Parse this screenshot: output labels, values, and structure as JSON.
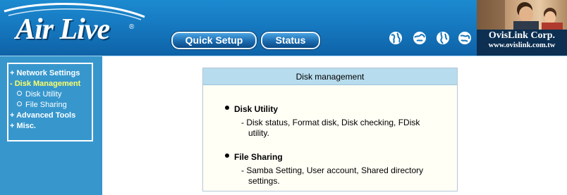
{
  "header": {
    "logo_text": "Air Live",
    "logo_mark": "®",
    "nav": [
      {
        "label": "Quick Setup"
      },
      {
        "label": "Status"
      }
    ],
    "icons": [
      "globe-icon",
      "globe-icon",
      "globe-icon",
      "globe-icon"
    ],
    "brand": {
      "name": "OvisLink Corp.",
      "url": "www.ovislink.com.tw"
    }
  },
  "sidebar": {
    "items": [
      {
        "label": "+ Network Settings",
        "active": false
      },
      {
        "label": "- Disk Management",
        "active": true
      },
      {
        "label": "Disk Utility",
        "sub": true
      },
      {
        "label": "File Sharing",
        "sub": true
      },
      {
        "label": "+ Advanced Tools",
        "active": false
      },
      {
        "label": "+ Misc.",
        "active": false
      }
    ]
  },
  "main": {
    "panel_title": "Disk management",
    "sections": [
      {
        "title": "Disk Utility",
        "desc_line1": "- Disk status, Format disk, Disk checking, FDisk",
        "desc_line2": "utility."
      },
      {
        "title": "File Sharing",
        "desc_line1": "- Samba Setting, User account, Shared directory",
        "desc_line2": "settings."
      }
    ]
  },
  "colors": {
    "header_blue": "#1476bd",
    "sidebar_blue": "#3797cd",
    "active_menu": "#ffff66",
    "panel_header": "#b7dcee"
  }
}
